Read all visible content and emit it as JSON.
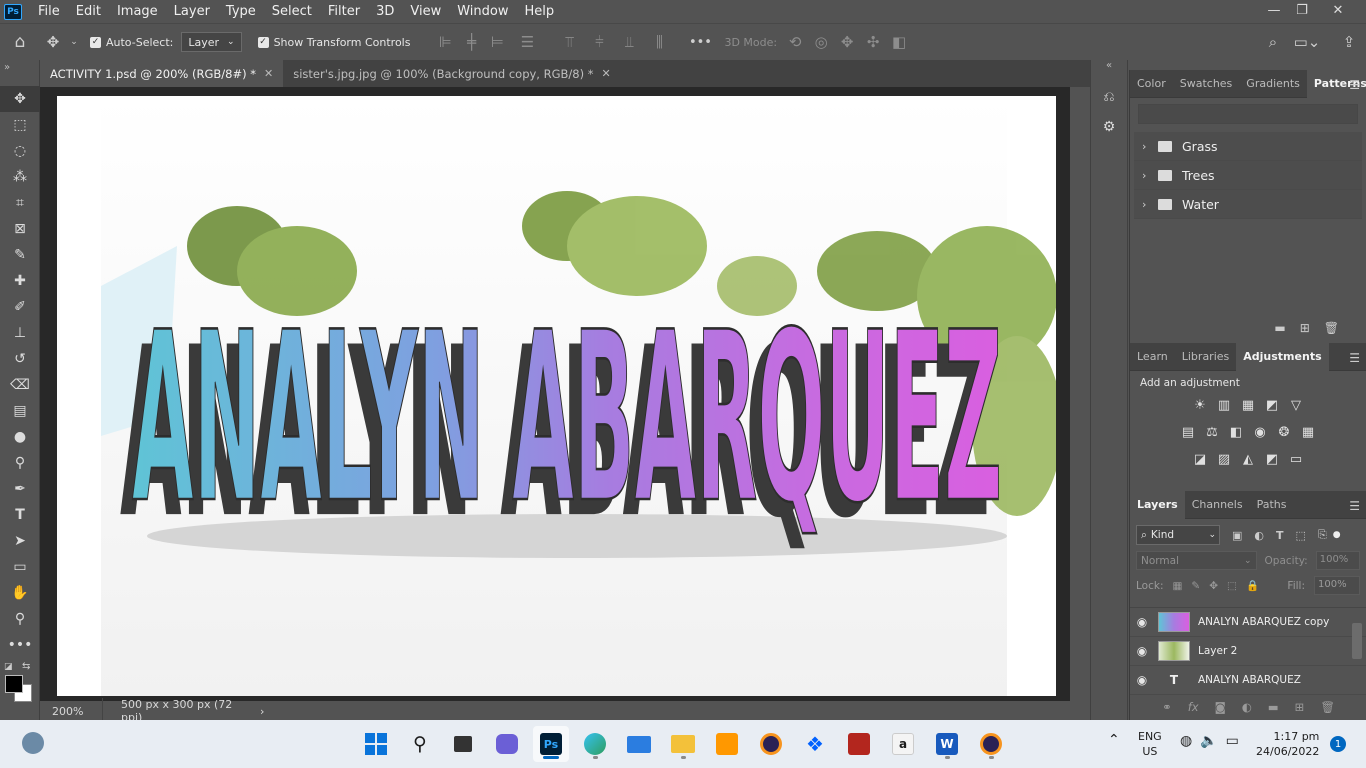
{
  "app": {
    "logo": "Ps",
    "menu": [
      "File",
      "Edit",
      "Image",
      "Layer",
      "Type",
      "Select",
      "Filter",
      "3D",
      "View",
      "Window",
      "Help"
    ],
    "window_controls": {
      "minimize": "—",
      "restore": "❐",
      "close": "✕"
    }
  },
  "options_bar": {
    "auto_select_label": "Auto-Select:",
    "auto_select_target": "Layer",
    "show_transform_label": "Show Transform Controls",
    "more": "•••",
    "mode_3d_label": "3D Mode:"
  },
  "tabs": [
    {
      "label": "ACTIVITY 1.psd @ 200% (RGB/8#) *",
      "close": "✕",
      "active": true
    },
    {
      "label": "sister's.jpg.jpg @ 100% (Background copy, RGB/8) *",
      "close": "✕",
      "active": false
    }
  ],
  "canvas": {
    "artwork_text": "ANALYN ABARQUEZ"
  },
  "status": {
    "zoom": "200%",
    "doc_info": "500 px x 300 px (72 ppi)",
    "arrow": "›"
  },
  "patterns_panel": {
    "tabs": [
      "Color",
      "Swatches",
      "Gradients",
      "Patterns"
    ],
    "active_tab": "Patterns",
    "folders": [
      "Grass",
      "Trees",
      "Water"
    ]
  },
  "adjustments_panel": {
    "tabs": [
      "Learn",
      "Libraries",
      "Adjustments"
    ],
    "active_tab": "Adjustments",
    "hint": "Add an adjustment"
  },
  "layers_panel": {
    "tabs": [
      "Layers",
      "Channels",
      "Paths"
    ],
    "active_tab": "Layers",
    "filter_kind": "Kind",
    "blend_mode": "Normal",
    "opacity_label": "Opacity:",
    "opacity_value": "100%",
    "lock_label": "Lock:",
    "fill_label": "Fill:",
    "fill_value": "100%",
    "layers": [
      {
        "name": "ANALYN ABARQUEZ copy",
        "type": "image"
      },
      {
        "name": "Layer 2",
        "type": "image"
      },
      {
        "name": "ANALYN ABARQUEZ",
        "type": "text",
        "type_glyph": "T"
      }
    ]
  },
  "taskbar": {
    "lang_top": "ENG",
    "lang_bottom": "US",
    "time": "1:17 pm",
    "date": "24/06/2022",
    "notification_count": "1",
    "ps_icon_label": "Ps",
    "word_icon_label": "W"
  }
}
